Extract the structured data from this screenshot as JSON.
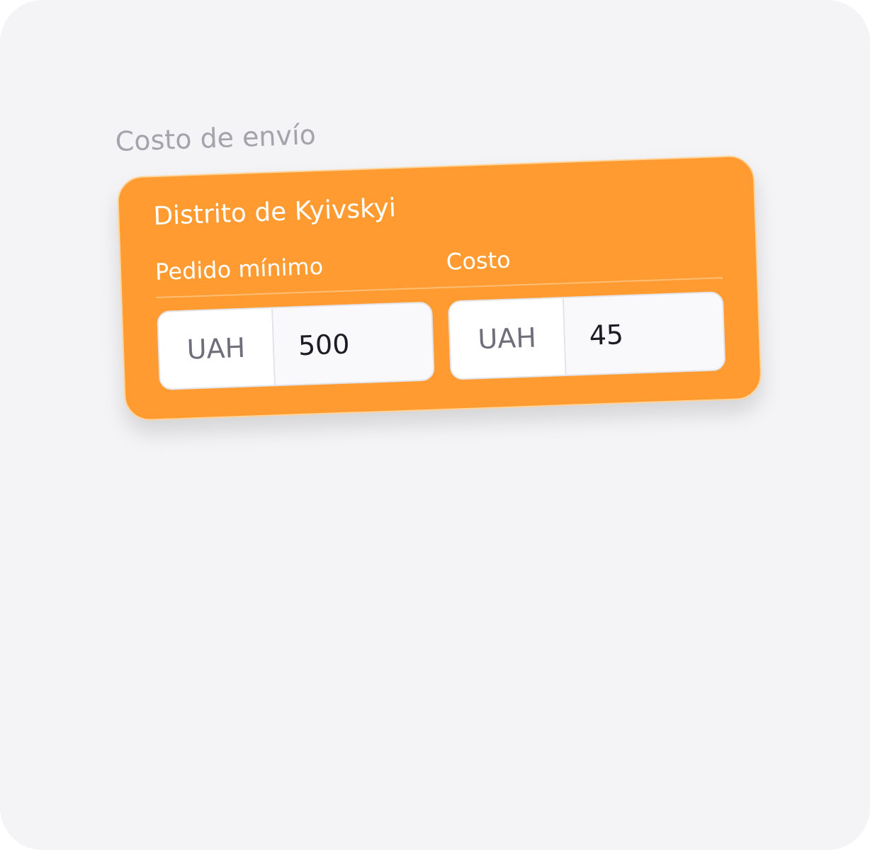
{
  "section_title": "Costo de envío",
  "card": {
    "title": "Distrito de Kyivskyi",
    "fields": [
      {
        "label": "Pedido mínimo",
        "prefix": "UAH",
        "value": "500"
      },
      {
        "label": "Costo",
        "prefix": "UAH",
        "value": "45"
      }
    ]
  }
}
